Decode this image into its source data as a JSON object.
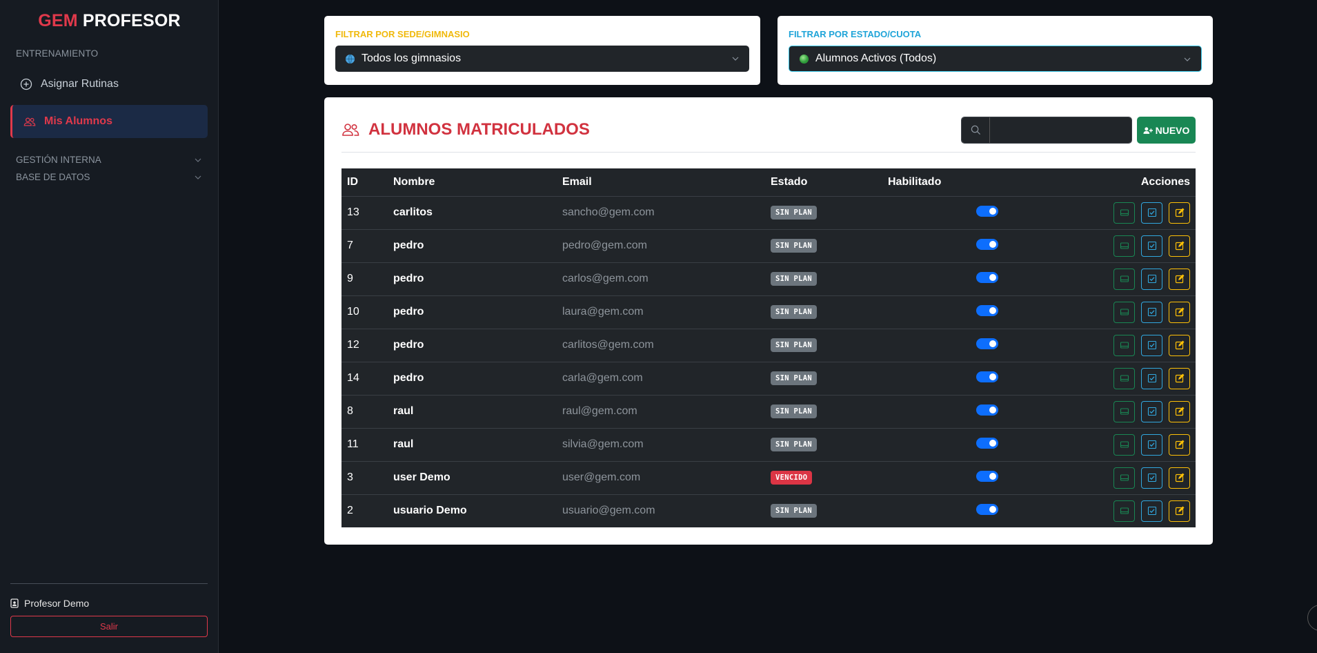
{
  "brand": {
    "part1": "GEM",
    "part2": "PROFESOR"
  },
  "sidebar": {
    "section_training": "ENTRENAMIENTO",
    "items": [
      {
        "label": "Asignar Rutinas",
        "icon": "plus-circle-icon"
      },
      {
        "label": "Mis Alumnos",
        "icon": "users-icon",
        "active": true
      }
    ],
    "collapsibles": [
      {
        "label": "GESTIÓN INTERNA"
      },
      {
        "label": "BASE DE DATOS"
      }
    ],
    "user_name": "Profesor Demo",
    "logout_label": "Salir"
  },
  "filters": {
    "gym": {
      "title": "FILTRAR POR SEDE/GIMNASIO",
      "value": "Todos los gimnasios",
      "icon": "globe-icon"
    },
    "status": {
      "title": "FILTRAR POR ESTADO/CUOTA",
      "value": "Alumnos Activos (Todos)",
      "icon": "green-dot-icon"
    }
  },
  "main": {
    "title": "ALUMNOS MATRICULADOS",
    "search_placeholder": "",
    "new_label": "NUEVO",
    "columns": {
      "id": "ID",
      "name": "Nombre",
      "email": "Email",
      "status": "Estado",
      "enabled": "Habilitado",
      "actions": "Acciones"
    },
    "rows": [
      {
        "id": "13",
        "name": "carlitos",
        "email": "sancho@gem.com",
        "status": "SIN PLAN",
        "status_color": "gray",
        "enabled": true
      },
      {
        "id": "7",
        "name": "pedro",
        "email": "pedro@gem.com",
        "status": "SIN PLAN",
        "status_color": "gray",
        "enabled": true
      },
      {
        "id": "9",
        "name": "pedro",
        "email": "carlos@gem.com",
        "status": "SIN PLAN",
        "status_color": "gray",
        "enabled": true
      },
      {
        "id": "10",
        "name": "pedro",
        "email": "laura@gem.com",
        "status": "SIN PLAN",
        "status_color": "gray",
        "enabled": true
      },
      {
        "id": "12",
        "name": "pedro",
        "email": "carlitos@gem.com",
        "status": "SIN PLAN",
        "status_color": "gray",
        "enabled": true
      },
      {
        "id": "14",
        "name": "pedro",
        "email": "carla@gem.com",
        "status": "SIN PLAN",
        "status_color": "gray",
        "enabled": true
      },
      {
        "id": "8",
        "name": "raul",
        "email": "raul@gem.com",
        "status": "SIN PLAN",
        "status_color": "gray",
        "enabled": true
      },
      {
        "id": "11",
        "name": "raul",
        "email": "silvia@gem.com",
        "status": "SIN PLAN",
        "status_color": "gray",
        "enabled": true
      },
      {
        "id": "3",
        "name": "user Demo",
        "email": "user@gem.com",
        "status": "VENCIDO",
        "status_color": "red",
        "enabled": true
      },
      {
        "id": "2",
        "name": "usuario Demo",
        "email": "usuario@gem.com",
        "status": "SIN PLAN",
        "status_color": "gray",
        "enabled": true
      }
    ]
  },
  "colors": {
    "accent_red": "#e0394b",
    "success_green": "#198754",
    "info_blue": "#31a8e0",
    "warning_yellow": "#ffc107",
    "toggle_blue": "#0d6efd"
  }
}
